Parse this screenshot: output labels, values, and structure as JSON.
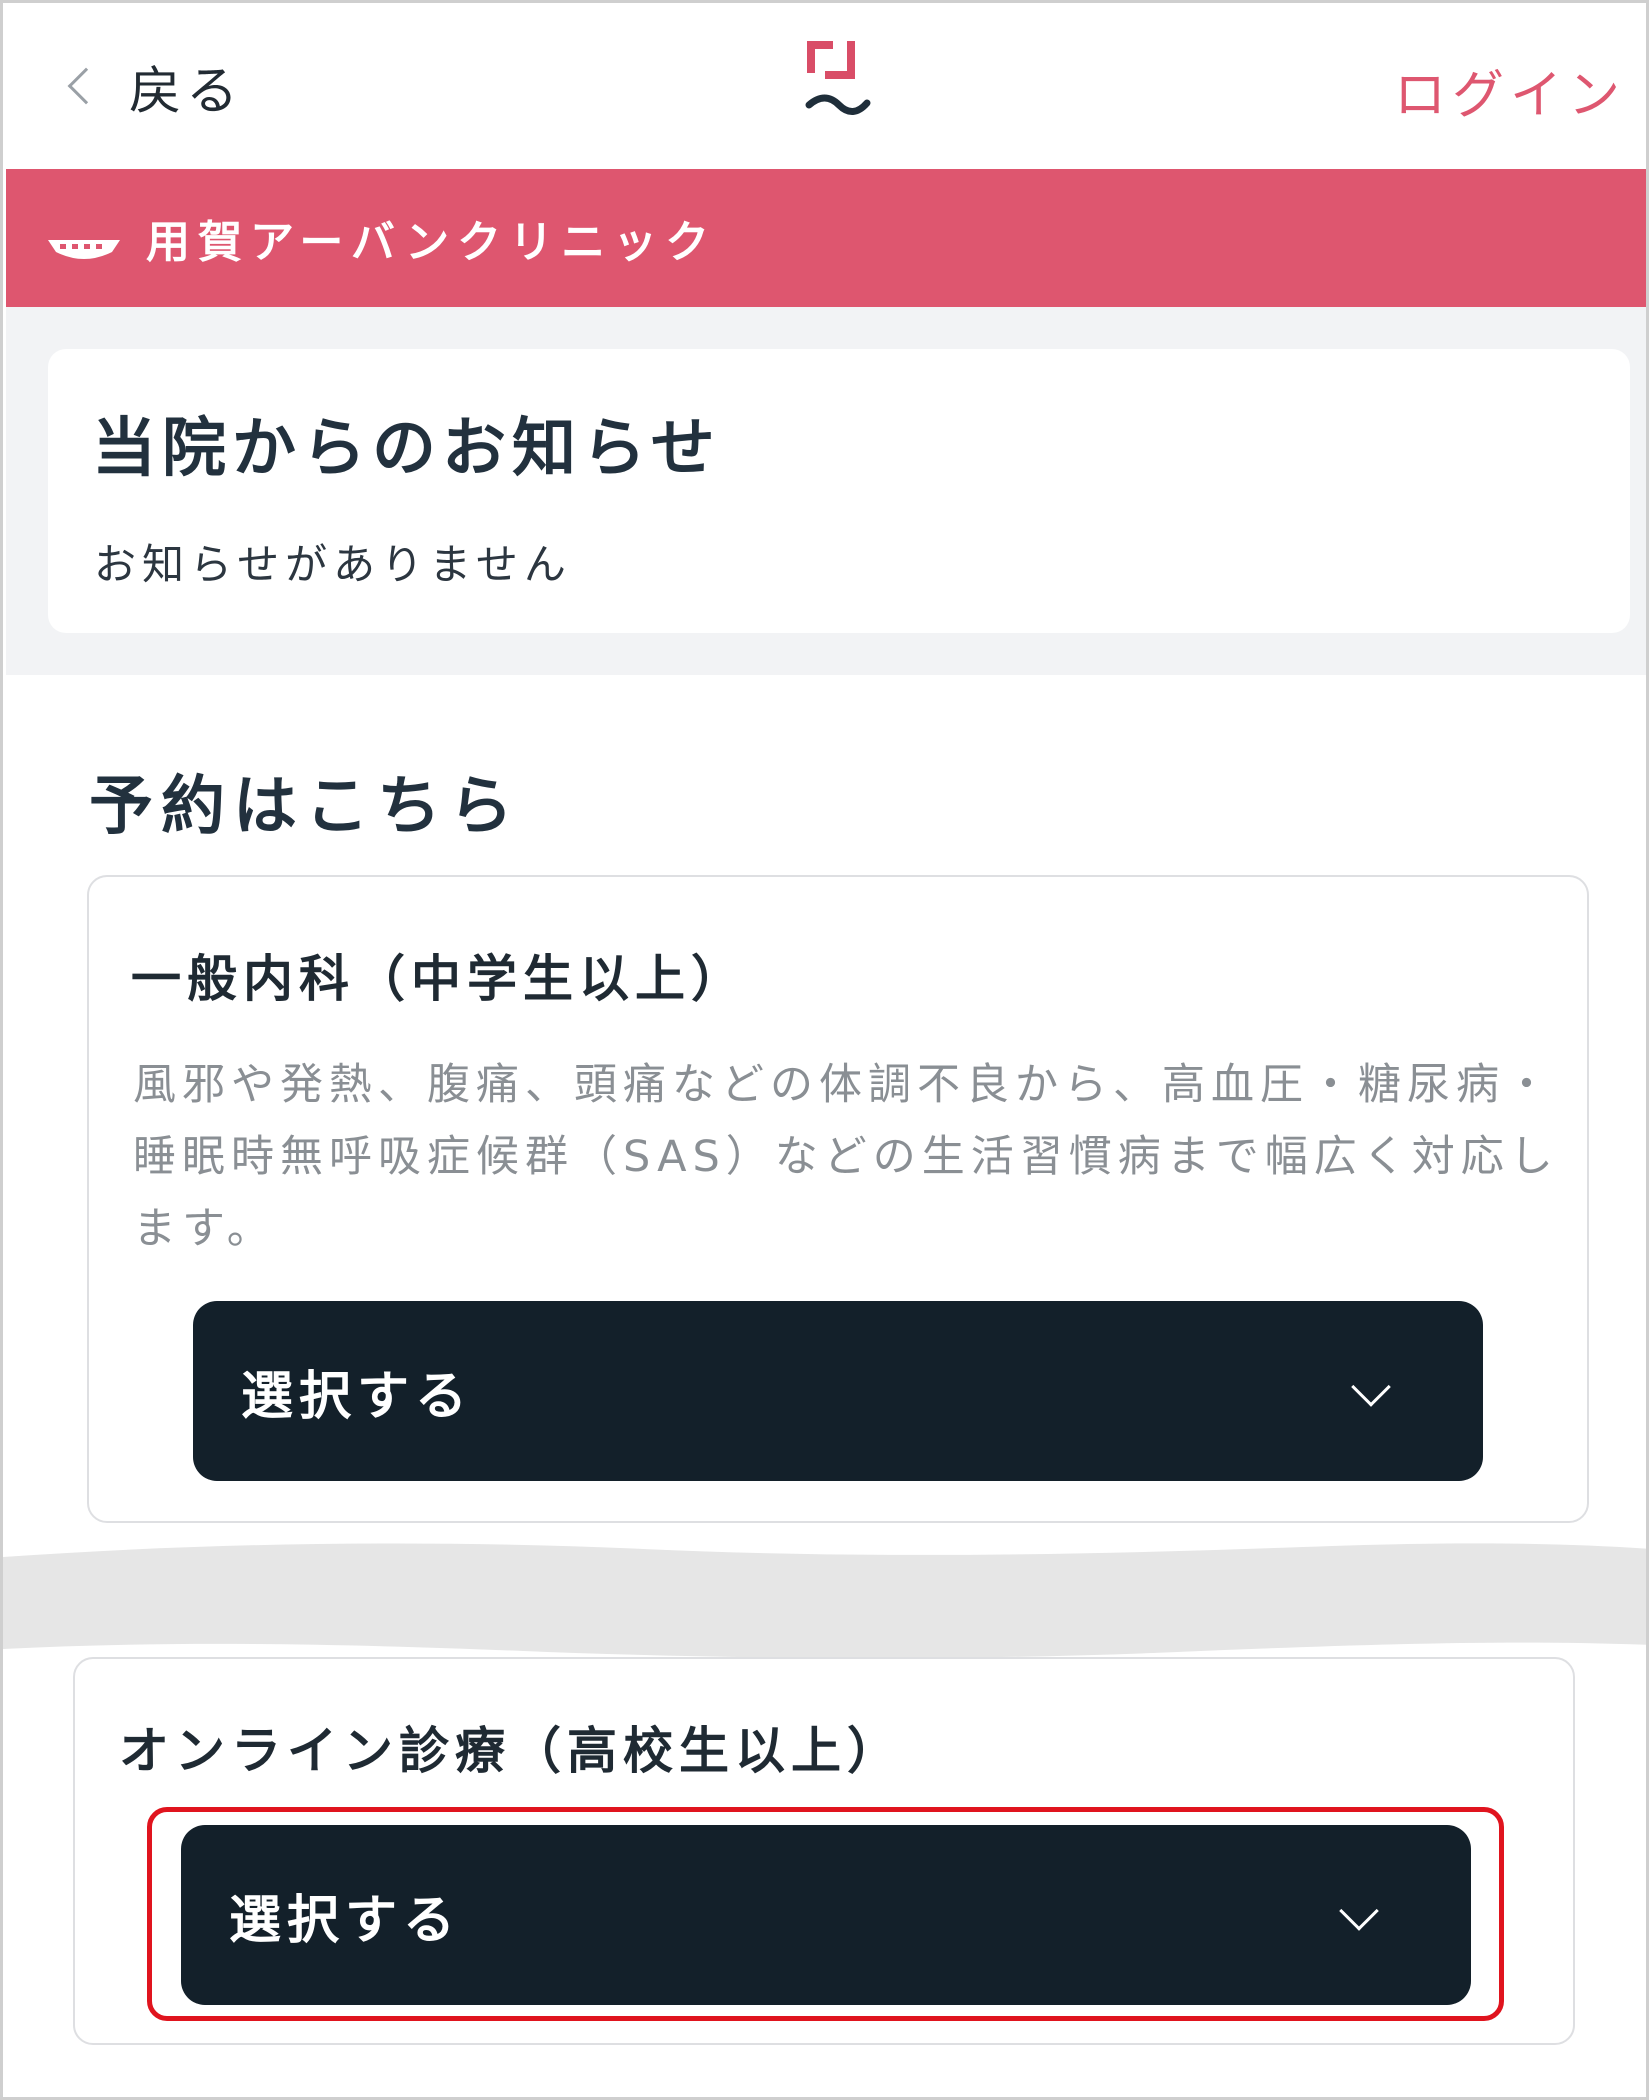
{
  "header": {
    "back_label": "戻る",
    "login_label": "ログイン",
    "logo_icon": "clinic-brand-logo-icon",
    "accent_color": "#de5770"
  },
  "clinic": {
    "name": "用賀アーバンクリニック",
    "banner_color": "#de566f",
    "icon": "clinic-emblem-icon"
  },
  "notice": {
    "title": "当院からのお知らせ",
    "empty_text": "お知らせがありません"
  },
  "reservation": {
    "title": "予約はこちら",
    "cards": [
      {
        "title": "一般内科（中学生以上）",
        "description": "風邪や発熱、腹痛、頭痛などの体調不良から、高血圧・糖尿病・睡眠時無呼吸症候群（SAS）などの生活習慣病まで幅広く対応します。",
        "select_label": "選択する"
      },
      {
        "title": "オンライン診療（高校生以上）",
        "select_label": "選択する"
      }
    ],
    "button_color": "#13202a",
    "highlight_color": "#e0141e"
  }
}
